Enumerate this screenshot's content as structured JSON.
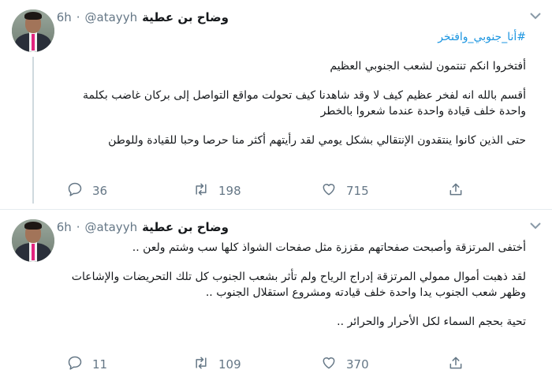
{
  "tweets": [
    {
      "display_name": "وضاح بن عطية",
      "handle": "@atayyh",
      "dot": "·",
      "time": "6h",
      "hashtag": "#أنا_جنوبي_وافتخر",
      "paragraphs": [
        "أفتخروا انكم تنتمون لشعب الجنوبي العظيم",
        "أقسم بالله انه لفخر عظيم كيف لا وقد شاهدنا كيف تحولت مواقع التواصل إلى بركان غاضب بكلمة واحدة خلف قيادة واحدة عندما شعروا بالخطر",
        "حتى الذين كانوا ينتقدون الإنتقالي بشكل يومي لقد رأيتهم أكثر منا حرصا وحبا للقيادة وللوطن"
      ],
      "replies": "36",
      "retweets": "198",
      "likes": "715"
    },
    {
      "display_name": "وضاح بن عطية",
      "handle": "@atayyh",
      "dot": "·",
      "time": "6h",
      "paragraphs": [
        "أختفى المرتزقة وأصبحت صفحاتهم مقززة مثل صفحات الشواذ كلها سب وشتم ولعن ..",
        "لقد ذهبت أموال ممولي المرتزقة إدراج الرياح ولم تأثر بشعب الجنوب كل تلك التحريضات والإشاعات وظهر شعب الجنوب يدا واحدة خلف قيادته ومشروع استقلال الجنوب ..",
        "تحية بحجم السماء لكل الأحرار والحرائر .."
      ],
      "replies": "11",
      "retweets": "109",
      "likes": "370"
    }
  ],
  "icons": {
    "reply": "reply-icon",
    "retweet": "retweet-icon",
    "like": "heart-icon",
    "share": "share-icon",
    "caret": "chevron-down-icon"
  },
  "colors": {
    "link": "#1b95e0",
    "secondary": "#657786",
    "divider": "#e6ecf0"
  }
}
